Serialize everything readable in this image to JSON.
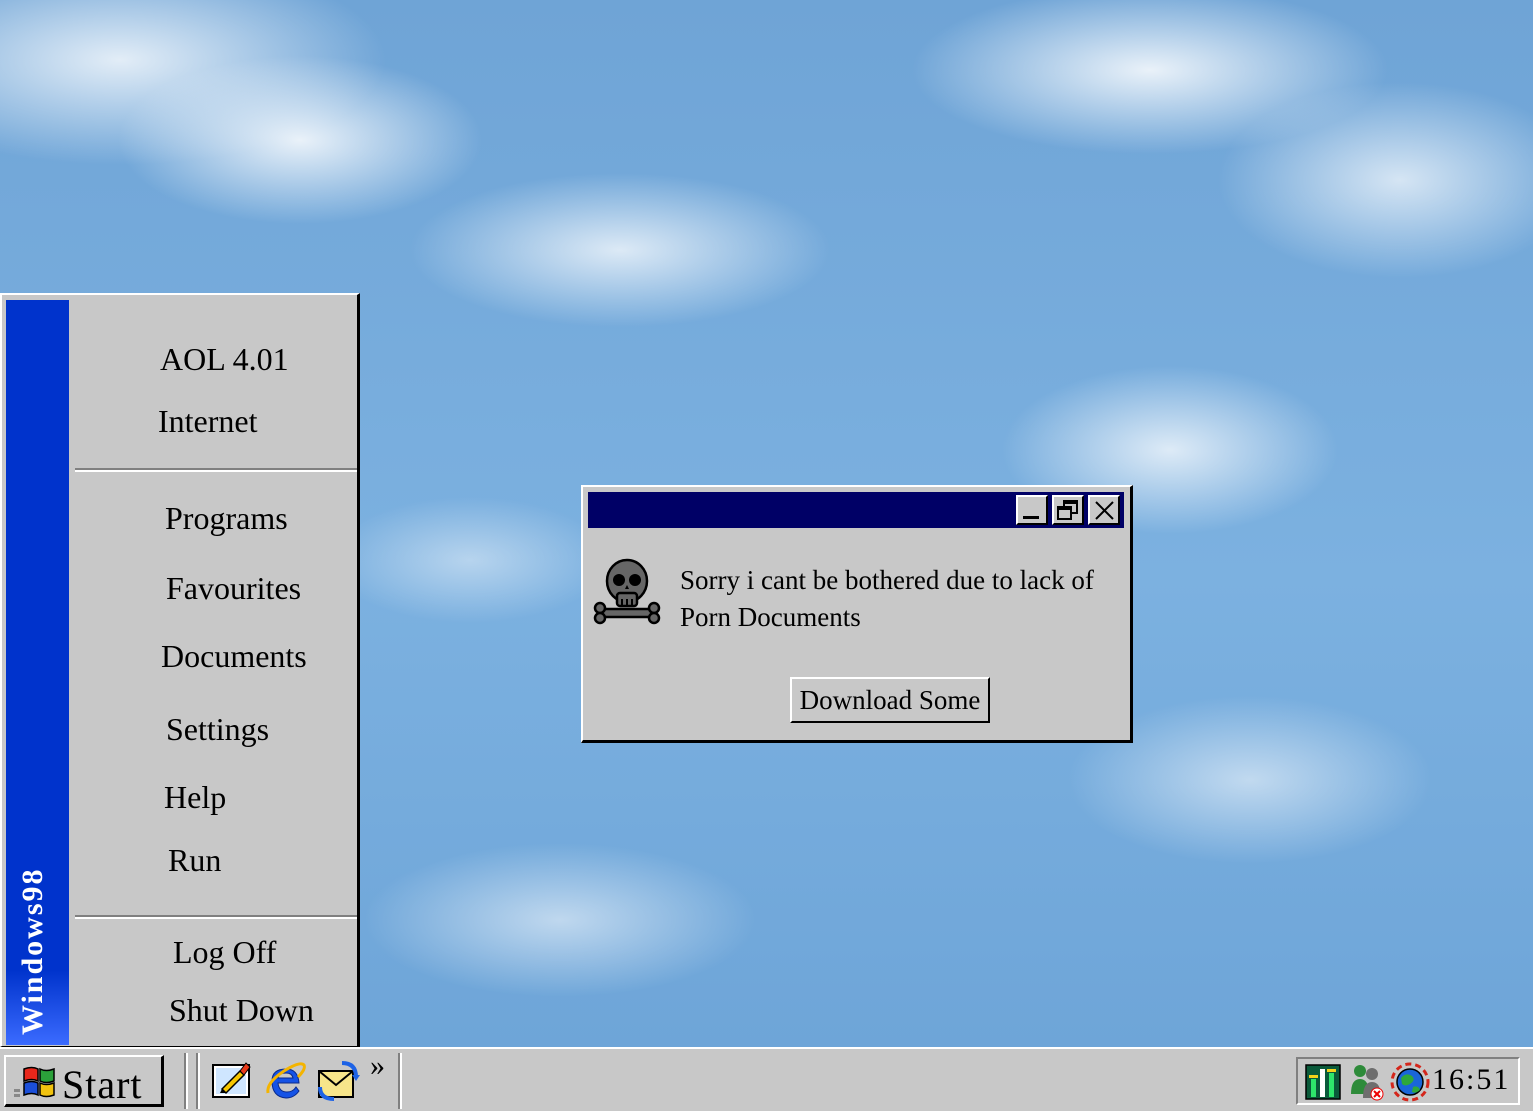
{
  "start_menu": {
    "banner": "Windows98",
    "top_items": [
      "AOL 4.01",
      "Internet"
    ],
    "main_items": [
      "Programs",
      "Favourites",
      "Documents",
      "Settings",
      "Help",
      "Run"
    ],
    "bottom_items": [
      "Log Off",
      "Shut Down"
    ]
  },
  "dialog": {
    "title": "",
    "message": "Sorry i cant be bothered due to lack of Porn Documents",
    "button_label": "Download Some",
    "icon": "skull-crossbones-icon"
  },
  "taskbar": {
    "start_label": "Start",
    "quick_launch_icons": [
      "show-desktop-icon",
      "internet-explorer-icon",
      "outlook-express-icon"
    ],
    "chevron": "»",
    "tray_icons": [
      "volume-meter-icon",
      "network-users-icon",
      "network-globe-icon"
    ],
    "clock": "16:51"
  },
  "colors": {
    "titlebar": "#000066",
    "banner": "#0033cc",
    "face": "#c8c8c8"
  }
}
